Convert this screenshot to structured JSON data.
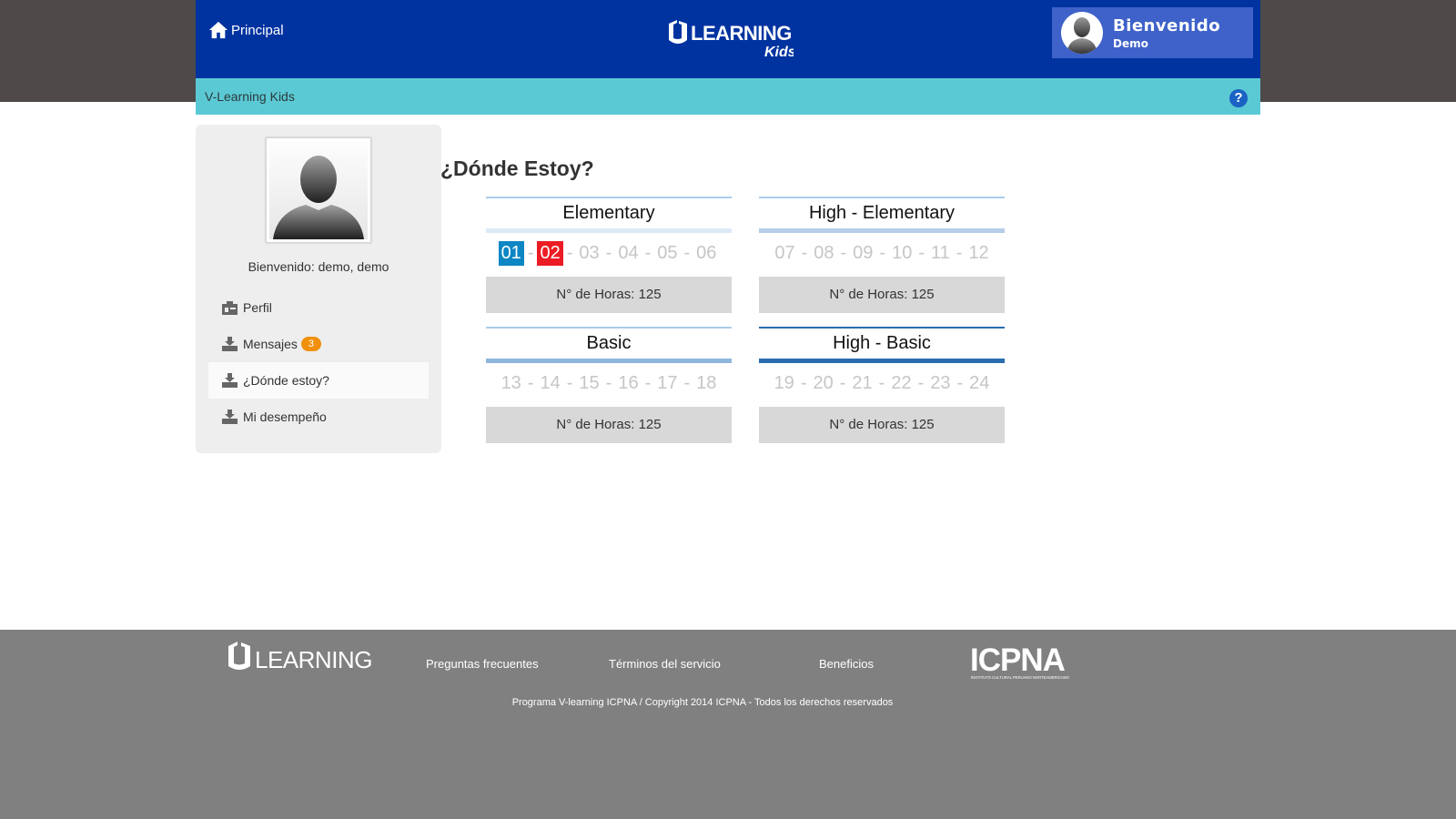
{
  "header": {
    "home_label": "Principal",
    "logo_text": "LEARNING",
    "logo_sub": "Kids",
    "welcome_title": "Bienvenido",
    "welcome_name": "Demo"
  },
  "subbar": {
    "title": "V-Learning Kids",
    "help_label": "?"
  },
  "sidebar": {
    "welcome": "Bienvenido: demo, demo",
    "items": [
      {
        "label": "Perfil",
        "icon": "id-card-icon"
      },
      {
        "label": "Mensajes",
        "icon": "inbox-icon",
        "badge": "3"
      },
      {
        "label": "¿Dónde estoy?",
        "icon": "inbox-icon",
        "active": true
      },
      {
        "label": "Mi desempeño",
        "icon": "inbox-icon"
      }
    ]
  },
  "main": {
    "title": "¿Dónde Estoy?",
    "levels": [
      {
        "name": "Elementary",
        "bar_color": "#dce9f7",
        "numbers": [
          "01",
          "02",
          "03",
          "04",
          "05",
          "06"
        ],
        "done": [
          "01"
        ],
        "current": "02",
        "hours": "N° de Horas: 125"
      },
      {
        "name": "High - Elementary",
        "bar_color": "#b5cde8",
        "numbers": [
          "07",
          "08",
          "09",
          "10",
          "11",
          "12"
        ],
        "done": [],
        "current": "",
        "hours": "N° de Horas: 125"
      },
      {
        "name": "Basic",
        "bar_color": "#8fb6de",
        "numbers": [
          "13",
          "14",
          "15",
          "16",
          "17",
          "18"
        ],
        "done": [],
        "current": "",
        "hours": "N° de Horas: 125"
      },
      {
        "name": "High - Basic",
        "bar_color": "#2a6cb0",
        "numbers": [
          "19",
          "20",
          "21",
          "22",
          "23",
          "24"
        ],
        "done": [],
        "current": "",
        "hours": "N° de Horas: 125"
      }
    ]
  },
  "footer": {
    "logo_text": "LEARNING",
    "links": [
      "Preguntas frecuentes",
      "Términos del servicio",
      "Beneficios"
    ],
    "partner_logo": "ICPNA",
    "partner_subtitle": "INSTITUTO CULTURAL PERUANO NORTEAMERICANO",
    "copyright": "Programa V-learning ICPNA / Copyright 2014 ICPNA - Todos los derechos reservados"
  },
  "colors": {
    "header_bg": "#0033a0",
    "subbar_bg": "#5bc9d4",
    "done_number": "#0d86c4",
    "current_number": "#ec1c24",
    "badge": "#f0900c"
  }
}
